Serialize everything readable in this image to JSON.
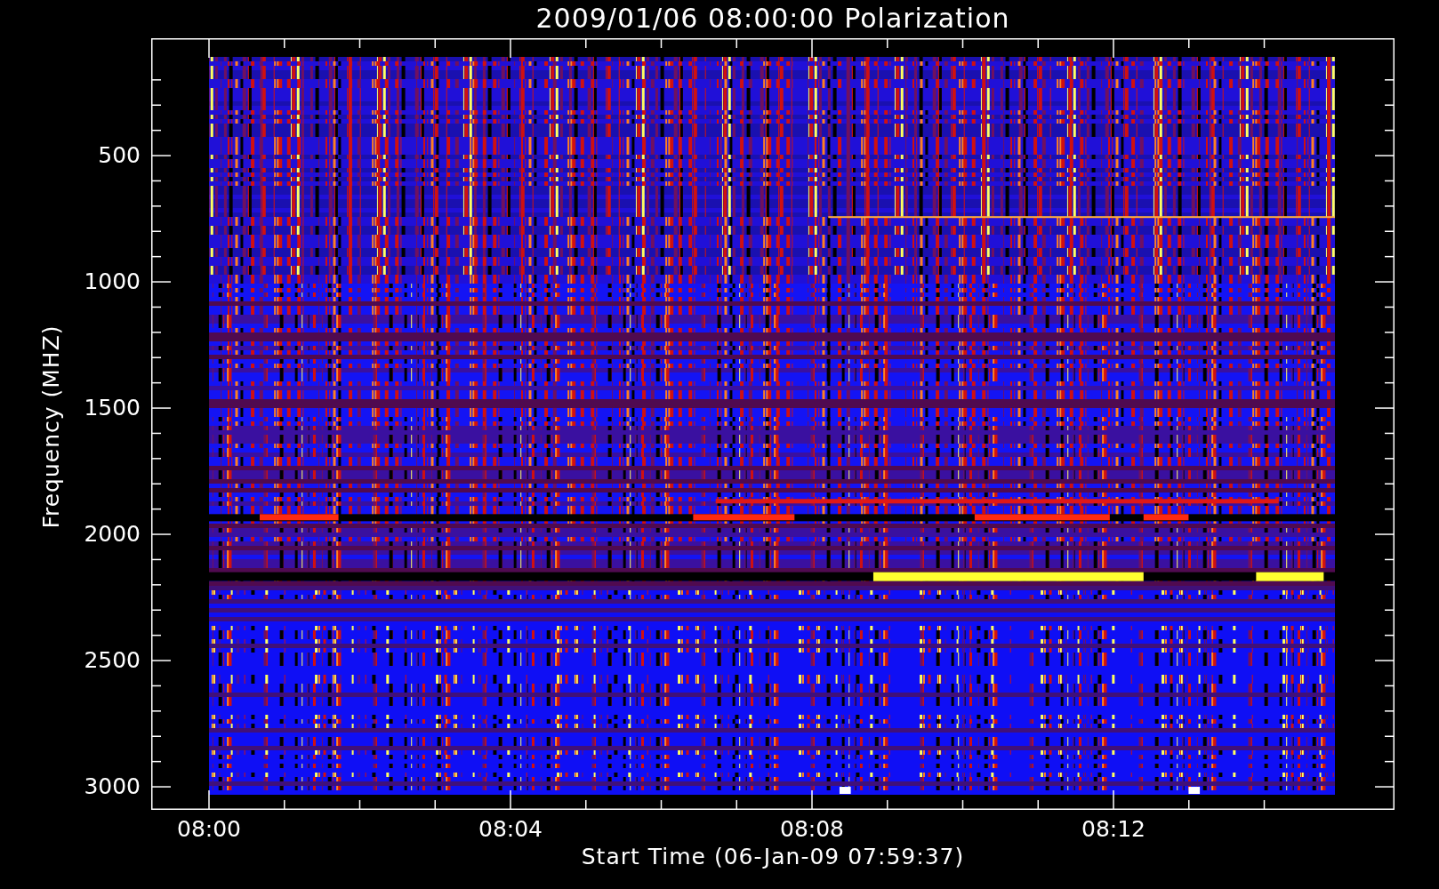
{
  "title": "2009/01/06 08:00:00 Polarization",
  "y_axis": {
    "label": "Frequency (MHZ)",
    "ticks": [
      {
        "label": "500"
      },
      {
        "label": "1000"
      },
      {
        "label": "1500"
      },
      {
        "label": "2000"
      },
      {
        "label": "2500"
      },
      {
        "label": "3000"
      }
    ]
  },
  "x_axis": {
    "label": "Start Time (06-Jan-09 07:59:37)",
    "ticks": [
      {
        "label": "08:00"
      },
      {
        "label": "08:04"
      },
      {
        "label": "08:08"
      },
      {
        "label": "08:12"
      }
    ]
  },
  "plot": {
    "kind": "spectrogram"
  }
}
